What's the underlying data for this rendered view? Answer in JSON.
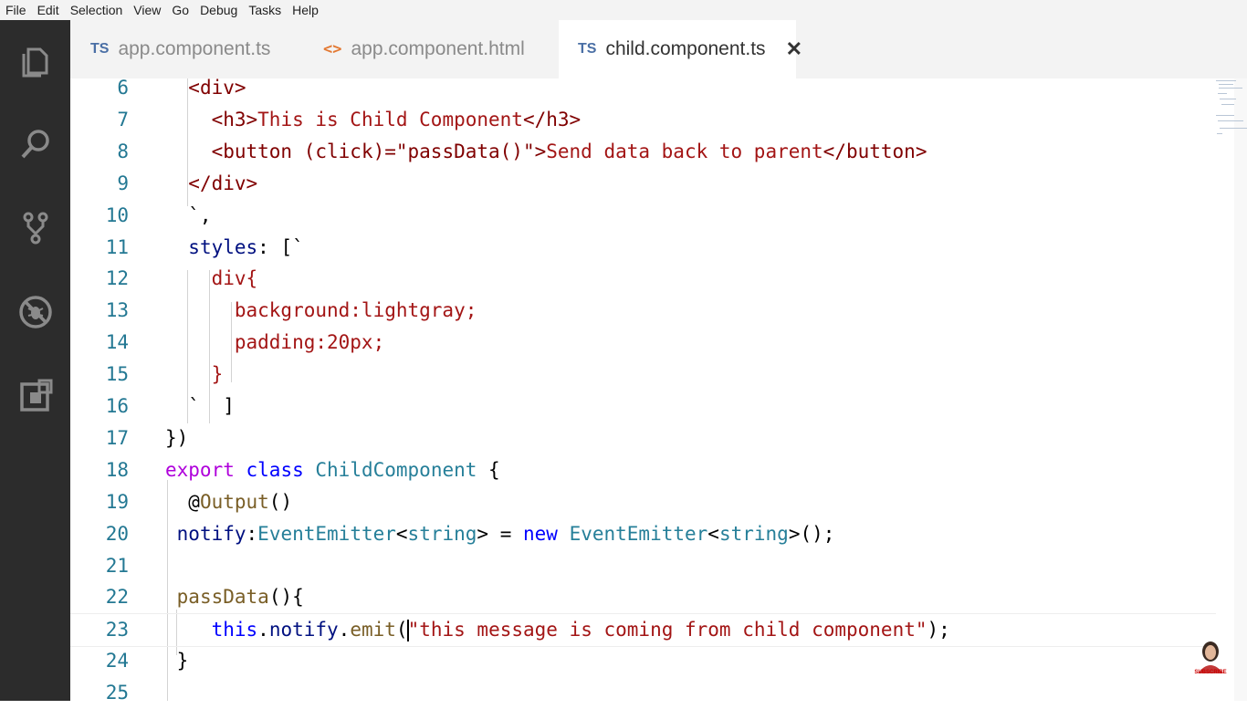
{
  "menu": [
    "File",
    "Edit",
    "Selection",
    "View",
    "Go",
    "Debug",
    "Tasks",
    "Help"
  ],
  "activity_bar": {
    "icons": [
      "explorer-icon",
      "search-icon",
      "source-control-icon",
      "debug-icon",
      "extensions-icon"
    ]
  },
  "tabs": [
    {
      "badge": "TS",
      "label": "app.component.ts",
      "active": false
    },
    {
      "badge": "<>",
      "label": "app.component.html",
      "active": false
    },
    {
      "badge": "TS",
      "label": "child.component.ts",
      "active": true,
      "close": "✕"
    }
  ],
  "editor": {
    "lines": [
      {
        "num": "6",
        "tokens": [
          {
            "c": "t-punc",
            "t": "  "
          },
          {
            "c": "t-tag",
            "t": "<div>"
          }
        ]
      },
      {
        "num": "7",
        "tokens": [
          {
            "c": "t-punc",
            "t": "    "
          },
          {
            "c": "t-tag",
            "t": "<h3>"
          },
          {
            "c": "t-str",
            "t": "This is Child Component"
          },
          {
            "c": "t-tag",
            "t": "</h3>"
          }
        ]
      },
      {
        "num": "8",
        "tokens": [
          {
            "c": "t-punc",
            "t": "    "
          },
          {
            "c": "t-tag",
            "t": "<button (click)=\"passData()\">"
          },
          {
            "c": "t-str",
            "t": "Send data back to parent"
          },
          {
            "c": "t-tag",
            "t": "</button>"
          }
        ]
      },
      {
        "num": "9",
        "tokens": [
          {
            "c": "t-punc",
            "t": "  "
          },
          {
            "c": "t-tag",
            "t": "</div>"
          }
        ]
      },
      {
        "num": "10",
        "tokens": [
          {
            "c": "t-punc",
            "t": "  `,"
          }
        ]
      },
      {
        "num": "11",
        "tokens": [
          {
            "c": "t-punc",
            "t": "  "
          },
          {
            "c": "t-var",
            "t": "styles"
          },
          {
            "c": "t-punc",
            "t": ": [`"
          }
        ]
      },
      {
        "num": "12",
        "tokens": [
          {
            "c": "t-punc",
            "t": "    "
          },
          {
            "c": "t-css",
            "t": "div{"
          }
        ]
      },
      {
        "num": "13",
        "tokens": [
          {
            "c": "t-punc",
            "t": "      "
          },
          {
            "c": "t-css",
            "t": "background:lightgray;"
          }
        ]
      },
      {
        "num": "14",
        "tokens": [
          {
            "c": "t-punc",
            "t": "      "
          },
          {
            "c": "t-css",
            "t": "padding:20px;"
          }
        ]
      },
      {
        "num": "15",
        "tokens": [
          {
            "c": "t-punc",
            "t": "    "
          },
          {
            "c": "t-css",
            "t": "}"
          }
        ]
      },
      {
        "num": "16",
        "tokens": [
          {
            "c": "t-punc",
            "t": "  `  ]"
          }
        ]
      },
      {
        "num": "17",
        "tokens": [
          {
            "c": "t-punc",
            "t": "})"
          }
        ]
      },
      {
        "num": "18",
        "tokens": [
          {
            "c": "t-kw2",
            "t": "export"
          },
          {
            "c": "t-punc",
            "t": " "
          },
          {
            "c": "t-kw",
            "t": "class"
          },
          {
            "c": "t-punc",
            "t": " "
          },
          {
            "c": "t-cls",
            "t": "ChildComponent"
          },
          {
            "c": "t-punc",
            "t": " {"
          }
        ]
      },
      {
        "num": "19",
        "tokens": [
          {
            "c": "t-punc",
            "t": "  @"
          },
          {
            "c": "t-fn",
            "t": "Output"
          },
          {
            "c": "t-punc",
            "t": "()"
          }
        ]
      },
      {
        "num": "20",
        "tokens": [
          {
            "c": "t-punc",
            "t": " "
          },
          {
            "c": "t-var",
            "t": "notify"
          },
          {
            "c": "t-punc",
            "t": ":"
          },
          {
            "c": "t-cls",
            "t": "EventEmitter"
          },
          {
            "c": "t-punc",
            "t": "<"
          },
          {
            "c": "t-cls",
            "t": "string"
          },
          {
            "c": "t-punc",
            "t": "> = "
          },
          {
            "c": "t-kw",
            "t": "new"
          },
          {
            "c": "t-punc",
            "t": " "
          },
          {
            "c": "t-cls",
            "t": "EventEmitter"
          },
          {
            "c": "t-punc",
            "t": "<"
          },
          {
            "c": "t-cls",
            "t": "string"
          },
          {
            "c": "t-punc",
            "t": ">();"
          }
        ]
      },
      {
        "num": "21",
        "tokens": []
      },
      {
        "num": "22",
        "tokens": [
          {
            "c": "t-punc",
            "t": " "
          },
          {
            "c": "t-fn",
            "t": "passData"
          },
          {
            "c": "t-punc",
            "t": "(){"
          }
        ]
      },
      {
        "num": "23",
        "current": true,
        "tokens": [
          {
            "c": "t-punc",
            "t": "    "
          },
          {
            "c": "t-kw",
            "t": "this"
          },
          {
            "c": "t-punc",
            "t": "."
          },
          {
            "c": "t-var",
            "t": "notify"
          },
          {
            "c": "t-punc",
            "t": "."
          },
          {
            "c": "t-fn",
            "t": "emit"
          },
          {
            "c": "t-punc",
            "t": "("
          },
          {
            "c": "cursor",
            "t": ""
          },
          {
            "c": "t-str",
            "t": "\"this message is coming from child component\""
          },
          {
            "c": "t-punc",
            "t": ");"
          }
        ]
      },
      {
        "num": "24",
        "tokens": [
          {
            "c": "t-punc",
            "t": " }"
          }
        ]
      },
      {
        "num": "25",
        "tokens": []
      }
    ]
  },
  "overlay": {
    "avatar_caption": "SUBSCRIBE"
  }
}
